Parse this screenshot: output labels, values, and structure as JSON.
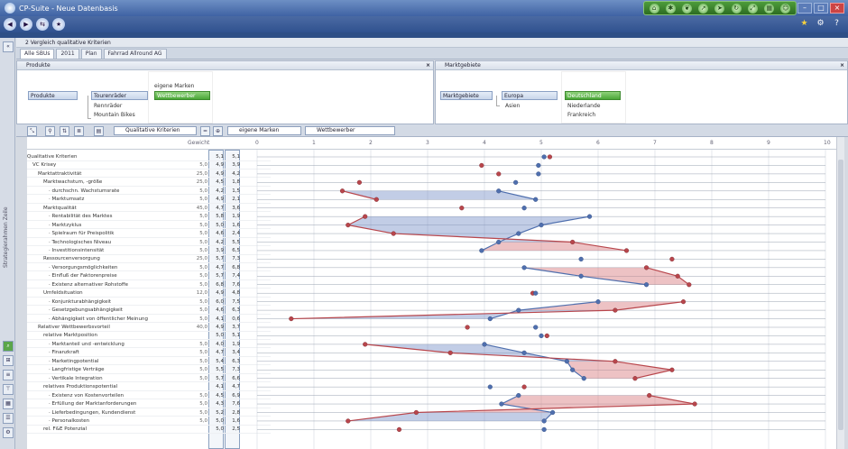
{
  "app": {
    "title": "CP-Suite - Neue Datenbasis"
  },
  "section": {
    "title": "2 Vergleich qualitative Kriterien"
  },
  "tabs": [
    {
      "label": "Alle SBUs"
    },
    {
      "label": "2011"
    },
    {
      "label": "Plan"
    },
    {
      "label": "Fahrrad Allround AG"
    }
  ],
  "products_panel": {
    "title": "Produkte",
    "root": "Produkte",
    "level1": [
      "Tourenräder",
      "Rennräder",
      "Mountain Bikes"
    ],
    "level2": [
      "eigene Marken",
      "Wettbewerber"
    ]
  },
  "markets_panel": {
    "title": "Marktgebiete",
    "root": "Marktgebiete",
    "level1": [
      "Europa",
      "Asien"
    ],
    "level2": [
      "Deutschland",
      "Niederlande",
      "Frankreich"
    ]
  },
  "controls": {
    "combo1": "Qualitative Kriterien",
    "combo2": "eigene Marken",
    "combo3": "Wettbewerber"
  },
  "grid": {
    "weight_header": "Gewicht",
    "ticks": [
      "0",
      "1",
      "2",
      "3",
      "4",
      "5",
      "6",
      "7",
      "8",
      "9",
      "10"
    ]
  },
  "sidebar": {
    "label": "Strategierahmen Zeile"
  },
  "colors": {
    "blue": "#4f6fae",
    "red": "#b8464c",
    "blue_fill": "rgba(120,145,200,0.45)",
    "red_fill": "rgba(215,120,125,0.45)"
  },
  "rows": [
    {
      "label": "Qualitative Kriterien",
      "indent": 0,
      "g": "",
      "v1": "5,1",
      "v2": "5,1",
      "b": 5.05,
      "r": 5.15
    },
    {
      "label": "VC Krisey",
      "indent": 1,
      "g": "5,0",
      "v1": "4,9",
      "v2": "3,9",
      "b": 4.95,
      "r": 3.95
    },
    {
      "label": "Marktattraktivität",
      "indent": 2,
      "g": "25,0",
      "v1": "4,9",
      "v2": "4,2",
      "b": 4.95,
      "r": 4.25
    },
    {
      "label": "Marktwachstum, -größe",
      "indent": 3,
      "g": "25,0",
      "v1": "4,5",
      "v2": "1,8",
      "b": 4.55,
      "r": 1.8
    },
    {
      "label": "durchschn. Wachstumsrate",
      "indent": 4,
      "g": "5,0",
      "v1": "4,2",
      "v2": "1,5",
      "b": 4.25,
      "r": 1.5
    },
    {
      "label": "Marktumsatz",
      "indent": 4,
      "g": "5,0",
      "v1": "4,9",
      "v2": "2,1",
      "b": 4.9,
      "r": 2.1
    },
    {
      "label": "Marktqualität",
      "indent": 3,
      "g": "45,0",
      "v1": "4,7",
      "v2": "3,6",
      "b": 4.7,
      "r": 3.6
    },
    {
      "label": "Rentabilität des Marktes",
      "indent": 4,
      "g": "5,0",
      "v1": "5,8",
      "v2": "1,9",
      "b": 5.85,
      "r": 1.9
    },
    {
      "label": "Marktzyklus",
      "indent": 4,
      "g": "5,0",
      "v1": "5,0",
      "v2": "1,6",
      "b": 5.0,
      "r": 1.6
    },
    {
      "label": "Spielraum für Preispolitik",
      "indent": 4,
      "g": "5,0",
      "v1": "4,6",
      "v2": "2,4",
      "b": 4.6,
      "r": 2.4
    },
    {
      "label": "Technologisches Niveau",
      "indent": 4,
      "g": "5,0",
      "v1": "4,2",
      "v2": "5,5",
      "b": 4.25,
      "r": 5.55
    },
    {
      "label": "Investitionsintensität",
      "indent": 4,
      "g": "5,0",
      "v1": "3,9",
      "v2": "6,5",
      "b": 3.95,
      "r": 6.5
    },
    {
      "label": "Ressourcenversorgung",
      "indent": 3,
      "g": "25,0",
      "v1": "5,7",
      "v2": "7,3",
      "b": 5.7,
      "r": 7.3
    },
    {
      "label": "Versorgungsmöglichkeiten",
      "indent": 4,
      "g": "5,0",
      "v1": "4,7",
      "v2": "6,8",
      "b": 4.7,
      "r": 6.85
    },
    {
      "label": "Einfluß der Faktorenpreise",
      "indent": 4,
      "g": "5,0",
      "v1": "5,7",
      "v2": "7,4",
      "b": 5.7,
      "r": 7.4
    },
    {
      "label": "Existenz alternativer Rohstoffe",
      "indent": 4,
      "g": "5,0",
      "v1": "6,8",
      "v2": "7,6",
      "b": 6.85,
      "r": 7.6
    },
    {
      "label": "Umfeldsituation",
      "indent": 3,
      "g": "12,0",
      "v1": "4,9",
      "v2": "4,8",
      "b": 4.9,
      "r": 4.85
    },
    {
      "label": "Konjunkturabhängigkeit",
      "indent": 4,
      "g": "5,0",
      "v1": "6,0",
      "v2": "7,5",
      "b": 6.0,
      "r": 7.5
    },
    {
      "label": "Gesetzgebungsabhängigkeit",
      "indent": 4,
      "g": "5,0",
      "v1": "4,6",
      "v2": "6,3",
      "b": 4.6,
      "r": 6.3
    },
    {
      "label": "Abhängigkeit von öffentlicher Meinung",
      "indent": 4,
      "g": "5,0",
      "v1": "4,1",
      "v2": "0,6",
      "b": 4.1,
      "r": 0.6
    },
    {
      "label": "Relativer Wettbewerbsvorteil",
      "indent": 2,
      "g": "40,0",
      "v1": "4,9",
      "v2": "3,7",
      "b": 4.9,
      "r": 3.7
    },
    {
      "label": "relative Marktposition",
      "indent": 3,
      "g": "",
      "v1": "5,0",
      "v2": "5,1",
      "b": 5.0,
      "r": 5.1
    },
    {
      "label": "Marktanteil und -entwicklung",
      "indent": 4,
      "g": "5,0",
      "v1": "4,0",
      "v2": "1,9",
      "b": 4.0,
      "r": 1.9
    },
    {
      "label": "Finanzkraft",
      "indent": 4,
      "g": "5,0",
      "v1": "4,7",
      "v2": "3,4",
      "b": 4.7,
      "r": 3.4
    },
    {
      "label": "Marketingpotential",
      "indent": 4,
      "g": "5,0",
      "v1": "5,4",
      "v2": "6,3",
      "b": 5.45,
      "r": 6.3
    },
    {
      "label": "Langfristige Verträge",
      "indent": 4,
      "g": "5,0",
      "v1": "5,5",
      "v2": "7,3",
      "b": 5.55,
      "r": 7.3
    },
    {
      "label": "Vertikale Integration",
      "indent": 4,
      "g": "5,0",
      "v1": "5,7",
      "v2": "6,6",
      "b": 5.75,
      "r": 6.65
    },
    {
      "label": "relatives Produktionspotential",
      "indent": 3,
      "g": "",
      "v1": "4,1",
      "v2": "4,7",
      "b": 4.1,
      "r": 4.7
    },
    {
      "label": "Existenz von Kostenvorteilen",
      "indent": 4,
      "g": "5,0",
      "v1": "4,5",
      "v2": "6,9",
      "b": 4.6,
      "r": 6.9
    },
    {
      "label": "Erfüllung der Marktanforderungen",
      "indent": 4,
      "g": "5,0",
      "v1": "4,3",
      "v2": "7,6",
      "b": 4.3,
      "r": 7.7
    },
    {
      "label": "Lieferbedingungen, Kundendienst",
      "indent": 4,
      "g": "5,0",
      "v1": "5,2",
      "v2": "2,8",
      "b": 5.2,
      "r": 2.8
    },
    {
      "label": "Personalkosten",
      "indent": 4,
      "g": "5,0",
      "v1": "5,0",
      "v2": "1,6",
      "b": 5.05,
      "r": 1.6
    },
    {
      "label": "rel. F&E Potenzial",
      "indent": 3,
      "g": "",
      "v1": "5,0",
      "v2": "2,5",
      "b": 5.05,
      "r": 2.5
    }
  ]
}
